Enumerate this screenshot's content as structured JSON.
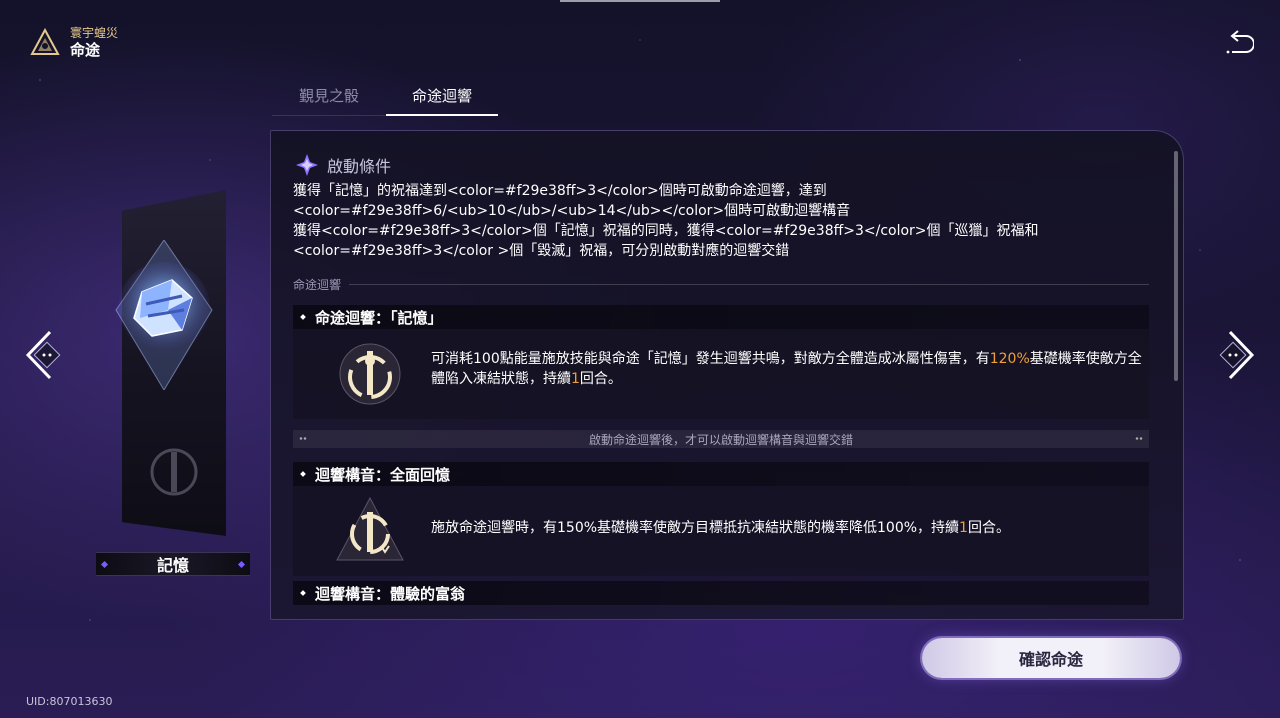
{
  "header": {
    "subtitle": "寰宇蝗災",
    "title": "命途"
  },
  "tabs": [
    {
      "label": "覲見之骰",
      "active": false
    },
    {
      "label": "命途迴響",
      "active": true
    }
  ],
  "path_card": {
    "name": "記憶"
  },
  "panel": {
    "condition_title": "啟動條件",
    "condition_text_1": "獲得「記憶」的祝福達到<color=#f29e38ff>3</color>個時可啟動命途迴響，達到<color=#f29e38ff>6/<ub>10</ub>/<ub>14</ub></color>個時可啟動迴響構音",
    "condition_text_2": "獲得<color=#f29e38ff>3</color>個「記憶」祝福的同時，獲得<color=#f29e38ff>3</color>個「巡獵」祝福和<color=#f29e38ff>3</color >個「毀滅」祝福，可分別啟動對應的迴響交錯",
    "section_label": "命途迴響",
    "resonance": {
      "title": "命途迴響：「記憶」",
      "desc_a": "可消耗100點能量施放技能與命途「記憶」發生迴響共鳴，對敵方全體造成冰屬性傷害，有",
      "desc_hl1": "120%",
      "desc_b": "基礎機率使敵方全體陷入凍結狀態，持續",
      "desc_hl2": "1",
      "desc_c": "回合。"
    },
    "unlock_notice": "啟動命途迴響後，才可以啟動迴響構音與迴響交錯",
    "formation_1": {
      "title": "迴響構音：全面回憶",
      "desc_a": "施放命途迴響時，有150%基礎機率使敵方目標抵抗凍結狀態的機率降低100%，持續",
      "desc_hl": "1",
      "desc_b": "回合。"
    },
    "formation_2": {
      "title": "迴響構音：體驗的富翁"
    }
  },
  "confirm_label": "確認命途",
  "uid": "UID:807013630",
  "colors": {
    "highlight": "#f29e38",
    "accent": "#7a5cff"
  },
  "icons": [
    "logo-icon",
    "back-icon",
    "path-crystal-icon",
    "memory-emblem-icon",
    "arrow-left-icon",
    "arrow-right-icon",
    "condition-icon"
  ]
}
